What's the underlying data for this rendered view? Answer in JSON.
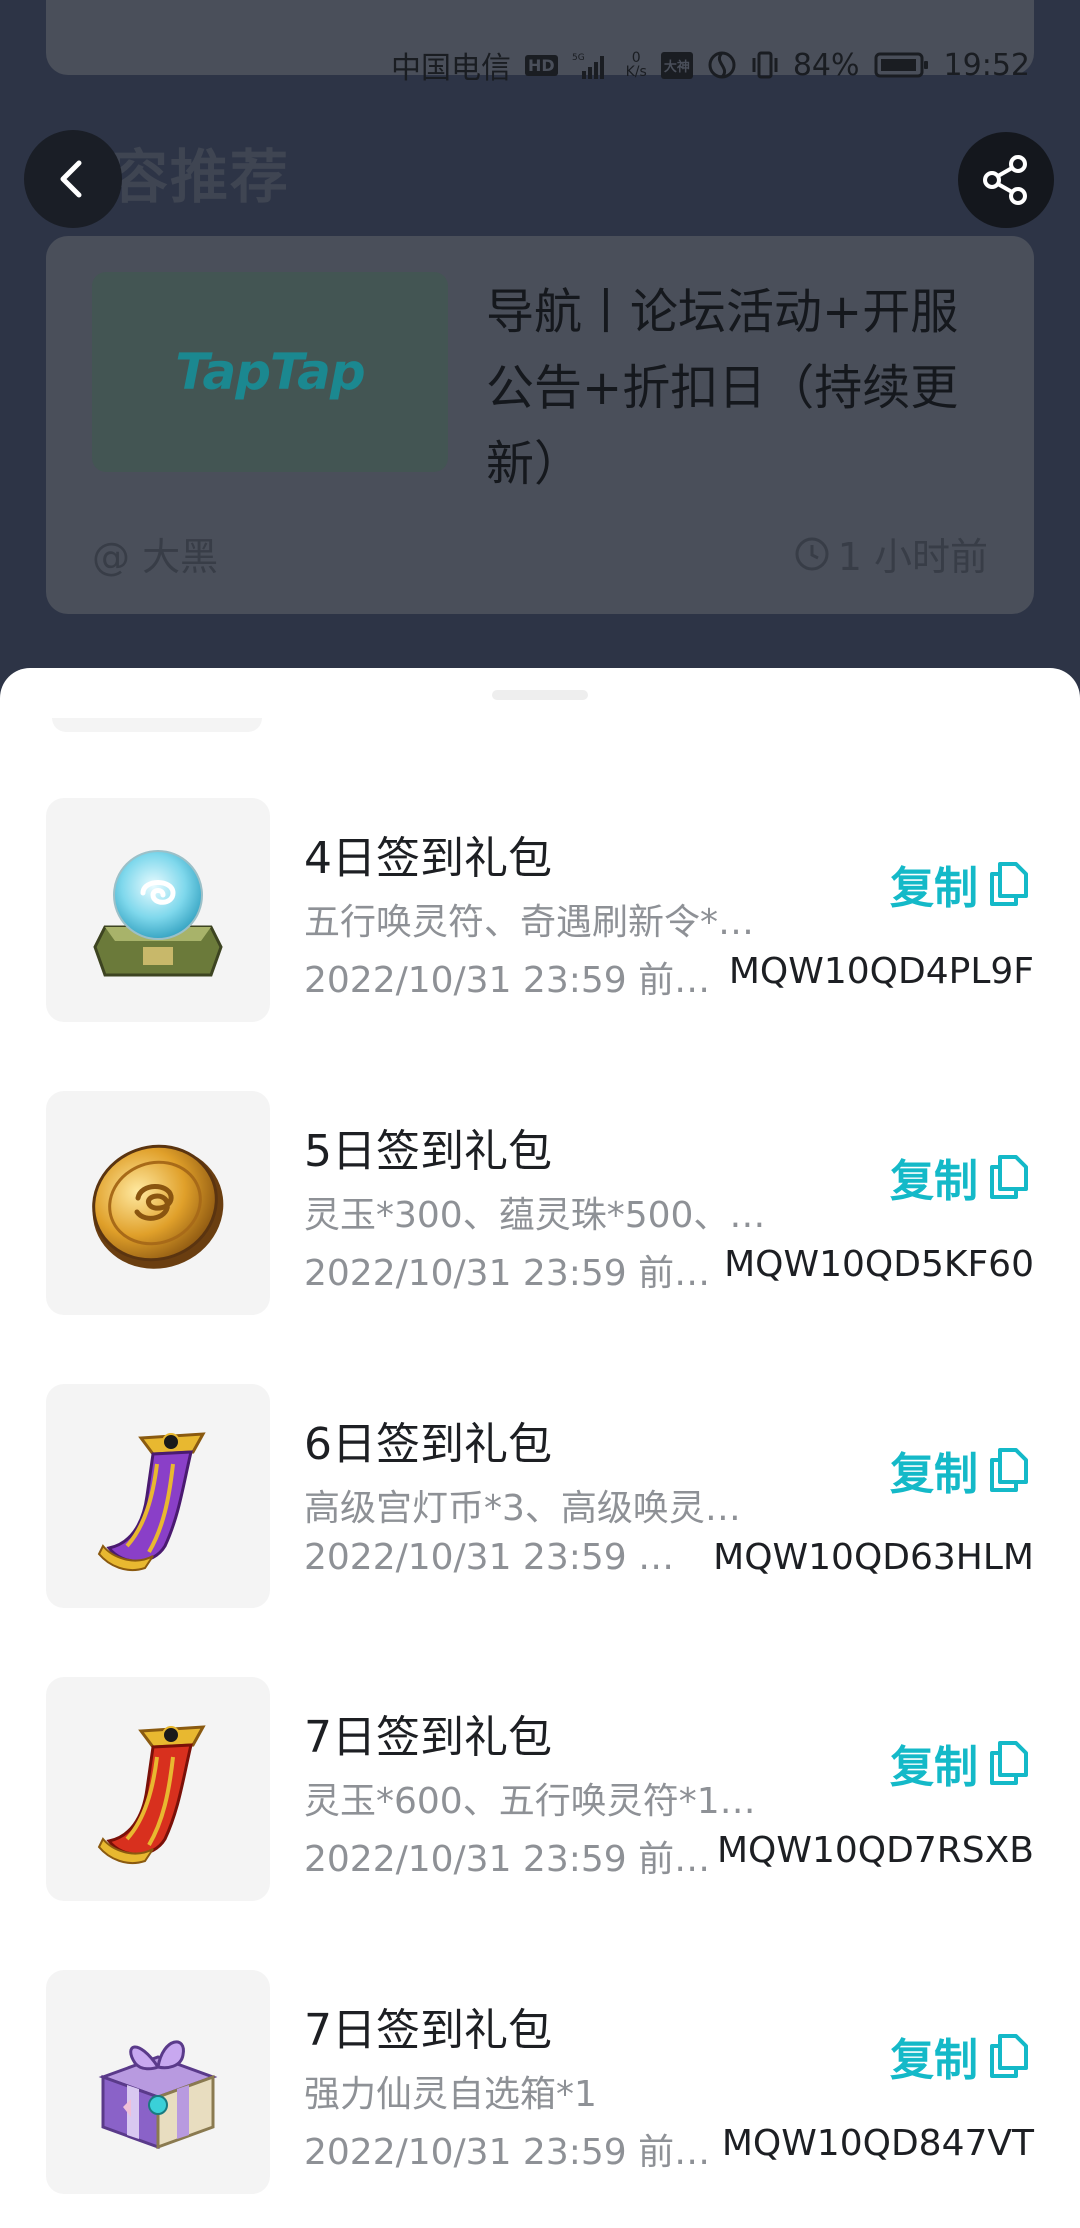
{
  "status_bar": {
    "carrier": "中国电信",
    "hd_badge": "HD",
    "network": "5G",
    "speed_value": "0",
    "speed_unit": "K/s",
    "app_badge": "大神",
    "battery": "84%",
    "time": "19:52"
  },
  "background": {
    "section_title": "内容推荐",
    "article": {
      "thumb_logo": "TapTap",
      "title": "导航丨论坛活动+开服公告+折扣日（持续更新）",
      "author": "@ 大黑",
      "time": "1 小时前"
    }
  },
  "gifts": [
    {
      "title": "4日签到礼包",
      "desc": "五行唤灵符、奇遇刷新令*…",
      "date": "2022/10/31 23:59 前…",
      "code": "MQW10QD4PL9F",
      "icon": "crystal-orb-icon",
      "copy_label": "复制"
    },
    {
      "title": "5日签到礼包",
      "desc": "灵玉*300、蕴灵珠*500、…",
      "date": "2022/10/31 23:59 前…",
      "code": "MQW10QD5KF60",
      "icon": "gold-coin-icon",
      "copy_label": "复制"
    },
    {
      "title": "6日签到礼包",
      "desc": "高级宫灯币*3、高级唤灵…",
      "date": "2022/10/31 23:59 …",
      "code": "MQW10QD63HLM",
      "icon": "purple-scroll-icon",
      "copy_label": "复制"
    },
    {
      "title": "7日签到礼包",
      "desc": "灵玉*600、五行唤灵符*1…",
      "date": "2022/10/31 23:59 前…",
      "code": "MQW10QD7RSXB",
      "icon": "red-scroll-icon",
      "copy_label": "复制"
    },
    {
      "title": "7日签到礼包",
      "desc": "强力仙灵自选箱*1",
      "date": "2022/10/31 23:59 前…",
      "code": "MQW10QD847VT",
      "icon": "gift-box-icon",
      "copy_label": "复制"
    }
  ],
  "colors": {
    "accent": "#14b9c8",
    "overlay_bg": "#2d3446"
  }
}
